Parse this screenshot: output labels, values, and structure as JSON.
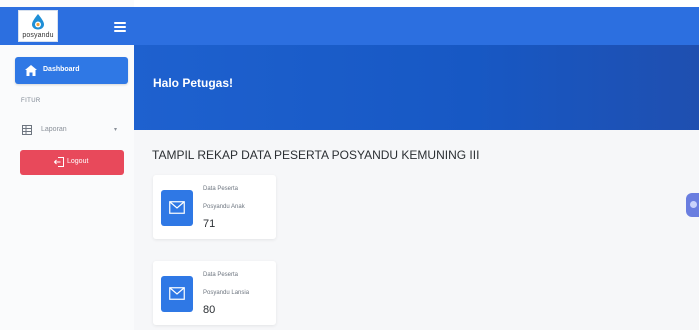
{
  "brand": {
    "logo_text": "posyandu"
  },
  "sidebar": {
    "dashboard_label": "Dashboard",
    "section_label": "FITUR",
    "laporan_label": "Laporan",
    "logout_label": "Logout"
  },
  "header": {
    "greeting": "Halo Petugas!"
  },
  "main": {
    "heading": "TAMPIL REKAP DATA PESERTA POSYANDU KEMUNING III",
    "cards": [
      {
        "line1": "Data Peserta",
        "line2": "Posyandu Anak",
        "value": "71"
      },
      {
        "line1": "Data Peserta",
        "line2": "Posyandu Lansia",
        "value": "80"
      }
    ]
  },
  "colors": {
    "primary": "#2c6fe0",
    "hero": "#1e61cf",
    "logout": "#e8495b",
    "card_icon": "#2f78e5"
  },
  "icons": {
    "menu": "hamburger-icon",
    "dashboard": "home-icon",
    "laporan": "table-icon",
    "logout": "logout-icon",
    "card": "envelope-icon"
  }
}
